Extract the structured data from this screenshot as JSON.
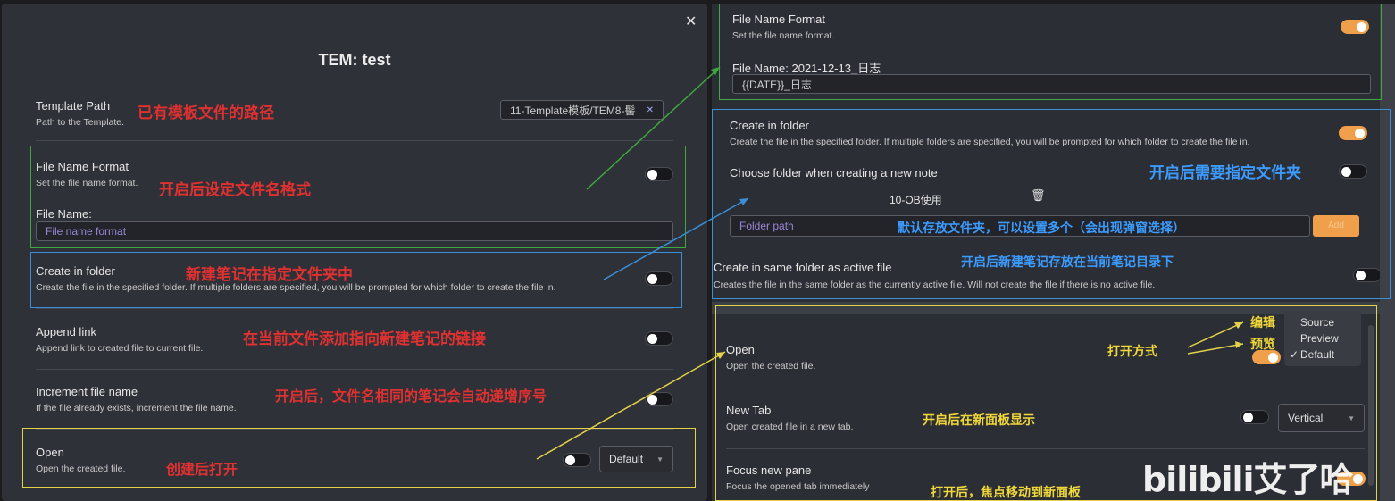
{
  "left": {
    "close_icon": "✕",
    "modal_title": "TEM: test",
    "template_path": {
      "title": "Template Path",
      "desc": "Path to the Template.",
      "value": "11-Template模板/TEM8-髻",
      "clear": "✕"
    },
    "file_name_format": {
      "title": "File Name Format",
      "desc": "Set the file name format.",
      "field_label": "File Name:",
      "placeholder": "File name format"
    },
    "create_in_folder": {
      "title": "Create in folder",
      "desc": "Create the file in the specified folder. If multiple folders are specified, you will be prompted for which folder to create the file in."
    },
    "append_link": {
      "title": "Append link",
      "desc": "Append link to created file to current file."
    },
    "increment": {
      "title": "Increment file name",
      "desc": "If the file already exists, increment the file name."
    },
    "open": {
      "title": "Open",
      "desc": "Open the created file.",
      "select": "Default"
    }
  },
  "right": {
    "file_name_format": {
      "title": "File Name Format",
      "desc": "Set the file name format.",
      "preview": "File Name: 2021-12-13_日志",
      "value": "{{DATE}}_日志"
    },
    "create_in_folder": {
      "title": "Create in folder",
      "desc": "Create the file in the specified folder. If multiple folders are specified, you will be prompted for which folder to create the file in.",
      "choose_label": "Choose folder when creating a new note",
      "folder_item": "10-OB使用",
      "delete_icon": "🗑",
      "folder_placeholder": "Folder path",
      "add_label": "Add"
    },
    "same_folder": {
      "title": "Create in same folder as active file",
      "desc": "Creates the file in the same folder as the currently active file. Will not create the file if there is no active file."
    },
    "open": {
      "title": "Open",
      "desc": "Open the created file.",
      "menu": [
        "Source",
        "Preview",
        "Default"
      ],
      "checked_mark": "✓"
    },
    "new_tab": {
      "title": "New Tab",
      "desc": "Open created file in a new tab.",
      "select": "Vertical"
    },
    "focus": {
      "title": "Focus new pane",
      "desc": "Focus the opened tab immediately"
    },
    "watermark": "bilibili艾了哈"
  },
  "annotations": {
    "template_path": "已有模板文件的路径",
    "file_name_format": "开启后设定文件名格式",
    "create_in_folder": "新建笔记在指定文件夹中",
    "append_link": "在当前文件添加指向新建笔记的链接",
    "increment": "开启后，文件名相同的笔记会自动递增序号",
    "open": "创建后打开",
    "choose_folder": "开启后需要指定文件夹",
    "default_folder": "默认存放文件夹，可以设置多个（会出现弹窗选择）",
    "same_folder": "开启后新建笔记存放在当前笔记目录下",
    "edit": "编辑",
    "preview": "预览",
    "open_mode": "打开方式",
    "new_tab": "开启后在新面板显示",
    "focus": "打开后，焦点移动到新面板"
  },
  "colors": {
    "accent": "#f0a04a",
    "annotation_red": "#e03131",
    "annotation_blue": "#3b9bff",
    "annotation_yellow": "#f0d83a",
    "box_green": "#3fa83f",
    "box_blue": "#3a8fd8",
    "box_yellow": "#e3d24a"
  }
}
